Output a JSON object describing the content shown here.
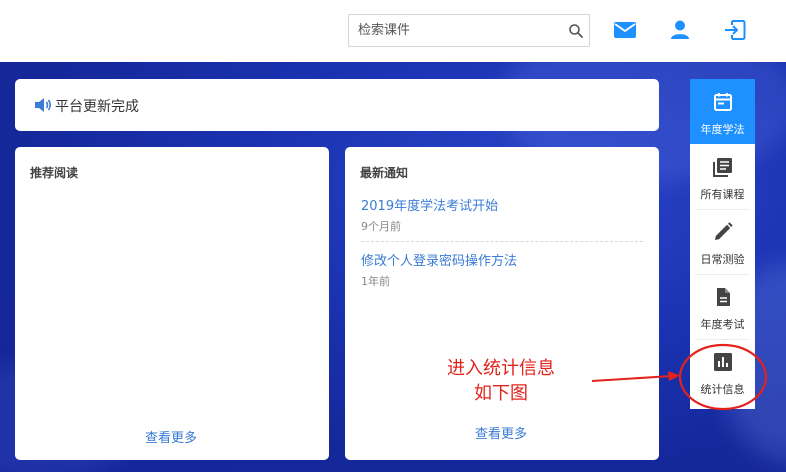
{
  "header": {
    "search": {
      "placeholder": "检索课件",
      "value": ""
    }
  },
  "announcement": {
    "text": "平台更新完成"
  },
  "recommended": {
    "title": "推荐阅读",
    "more": "查看更多"
  },
  "notices": {
    "title": "最新通知",
    "items": [
      {
        "title": "2019年度学法考试开始",
        "time": "9个月前"
      },
      {
        "title": "修改个人登录密码操作方法",
        "time": "1年前"
      }
    ],
    "more": "查看更多"
  },
  "sidebar": {
    "items": [
      {
        "label": "年度学法",
        "icon": "calendar-icon",
        "active": true
      },
      {
        "label": "所有课程",
        "icon": "library-icon",
        "active": false
      },
      {
        "label": "日常测验",
        "icon": "pencil-icon",
        "active": false
      },
      {
        "label": "年度考试",
        "icon": "document-icon",
        "active": false
      },
      {
        "label": "统计信息",
        "icon": "bar-chart-icon",
        "active": false
      }
    ]
  },
  "annotation": {
    "line1": "进入统计信息",
    "line2": "如下图",
    "color": "#e3221c"
  },
  "colors": {
    "accent": "#1e90ff",
    "link": "#3a7bd5",
    "background": "#1a32b0"
  }
}
